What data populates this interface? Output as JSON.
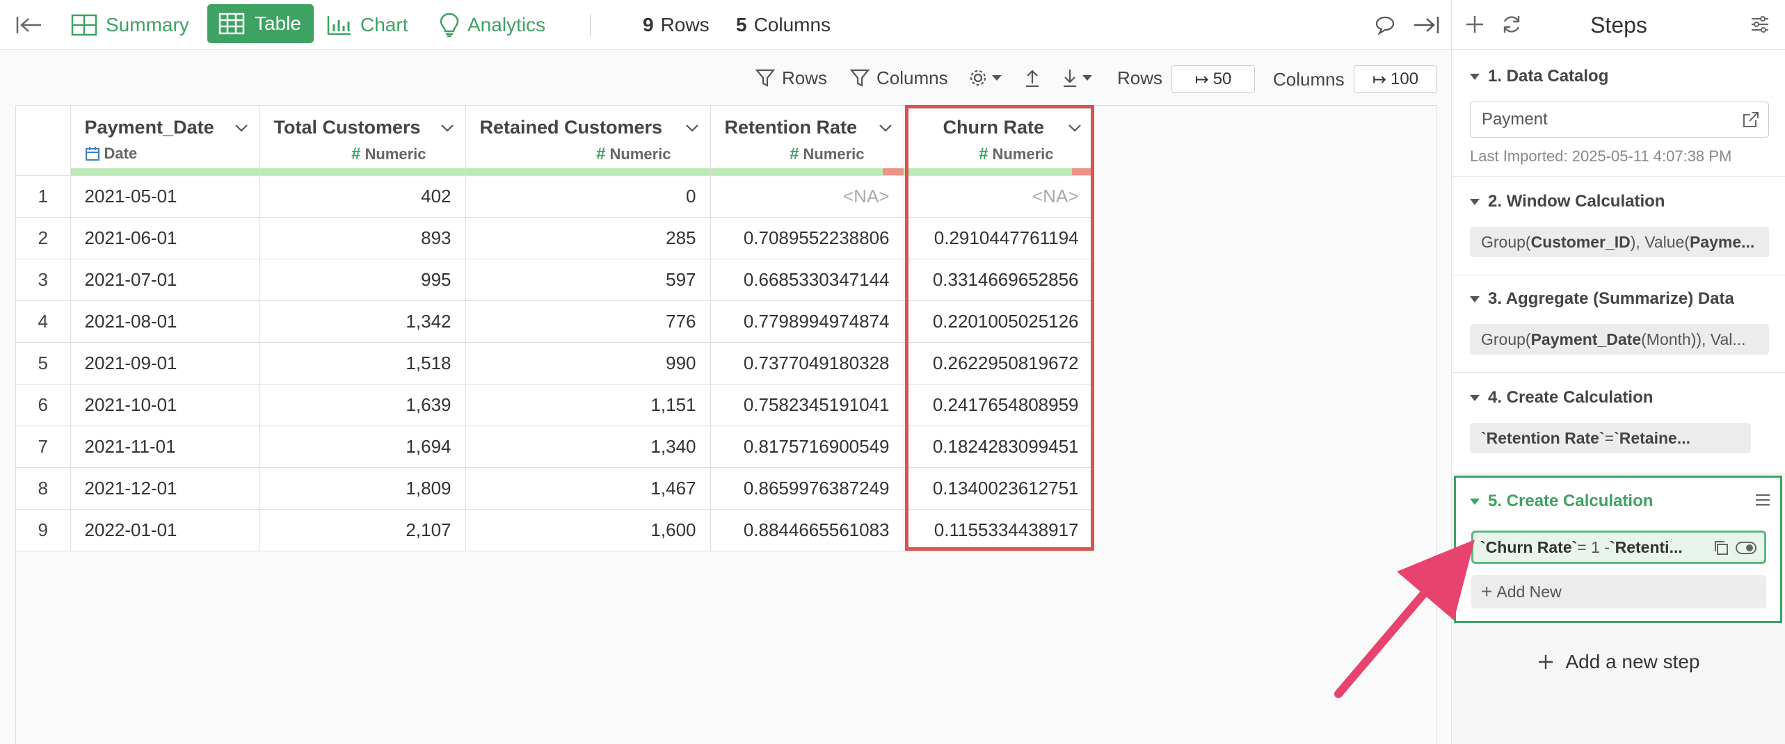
{
  "toolbar": {
    "tabs": {
      "summary": "Summary",
      "table": "Table",
      "chart": "Chart",
      "analytics": "Analytics"
    },
    "rows_count": "9",
    "rows_label": "Rows",
    "cols_count": "5",
    "cols_label": "Columns"
  },
  "subtoolbar": {
    "rows_filter": "Rows",
    "columns_filter": "Columns",
    "rows_label": "Rows",
    "rows_value": "50",
    "columns_label": "Columns",
    "columns_value": "100"
  },
  "table": {
    "columns": [
      {
        "name": "Payment_Date",
        "type": "Date"
      },
      {
        "name": "Total Customers",
        "type": "Numeric"
      },
      {
        "name": "Retained Customers",
        "type": "Numeric"
      },
      {
        "name": "Retention Rate",
        "type": "Numeric"
      },
      {
        "name": "Churn Rate",
        "type": "Numeric"
      }
    ],
    "rows": [
      {
        "idx": "1",
        "c": [
          "2021-05-01",
          "402",
          "0",
          "<NA>",
          "<NA>"
        ]
      },
      {
        "idx": "2",
        "c": [
          "2021-06-01",
          "893",
          "285",
          "0.7089552238806",
          "0.2910447761194"
        ]
      },
      {
        "idx": "3",
        "c": [
          "2021-07-01",
          "995",
          "597",
          "0.6685330347144",
          "0.3314669652856"
        ]
      },
      {
        "idx": "4",
        "c": [
          "2021-08-01",
          "1,342",
          "776",
          "0.7798994974874",
          "0.2201005025126"
        ]
      },
      {
        "idx": "5",
        "c": [
          "2021-09-01",
          "1,518",
          "990",
          "0.7377049180328",
          "0.2622950819672"
        ]
      },
      {
        "idx": "6",
        "c": [
          "2021-10-01",
          "1,639",
          "1,151",
          "0.7582345191041",
          "0.2417654808959"
        ]
      },
      {
        "idx": "7",
        "c": [
          "2021-11-01",
          "1,694",
          "1,340",
          "0.8175716900549",
          "0.1824283099451"
        ]
      },
      {
        "idx": "8",
        "c": [
          "2021-12-01",
          "1,809",
          "1,467",
          "0.8659976387249",
          "0.1340023612751"
        ]
      },
      {
        "idx": "9",
        "c": [
          "2022-01-01",
          "2,107",
          "1,600",
          "0.8844665561083",
          "0.1155334438917"
        ]
      }
    ]
  },
  "steps_panel": {
    "title": "Steps",
    "step1": {
      "title": "1. Data Catalog",
      "input": "Payment",
      "last_imported": "Last Imported: 2025-05-11 4:07:38 PM"
    },
    "step2": {
      "title": "2. Window Calculation",
      "a": "Group(",
      "b": "Customer_ID",
      "c": "), Value(",
      "d": "Payme..."
    },
    "step3": {
      "title": "3. Aggregate (Summarize) Data",
      "a": "Group(",
      "b": "Payment_Date",
      "c": " (Month)), Val..."
    },
    "step4": {
      "title": "4. Create Calculation",
      "a": "`Retention Rate`",
      "b": " = ",
      "c": "`Retaine..."
    },
    "step5": {
      "title": "5. Create Calculation",
      "a": "`Churn Rate`",
      "b": " = 1 - ",
      "c": "`Retenti..."
    },
    "add_new": "Add New",
    "add_step": "Add a new step"
  },
  "colors": {
    "accent": "#3da262",
    "highlight": "#d9534f",
    "arrow": "#e8436e"
  }
}
